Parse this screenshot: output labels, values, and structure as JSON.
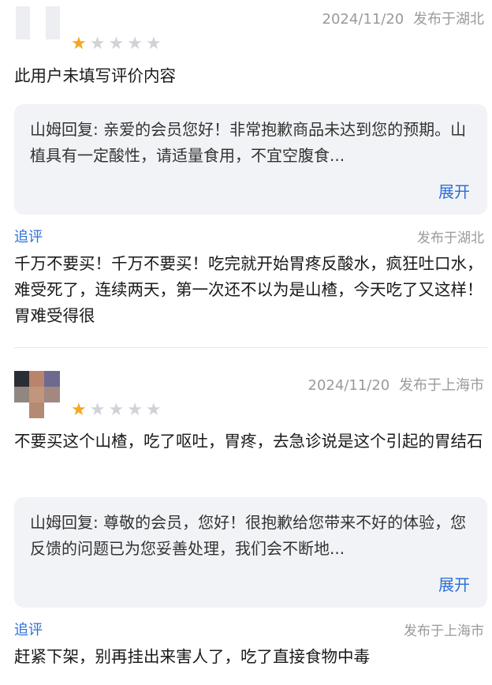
{
  "reviews": [
    {
      "date": "2024/11/20",
      "location": "发布于湖北",
      "rating": 1,
      "content": "此用户未填写评价内容",
      "reply": "山姆回复: 亲爱的会员您好！非常抱歉商品未达到您的预期。山植具有一定酸性，请适量食用，不宜空腹食...",
      "expand_label": "展开",
      "followup_label": "追评",
      "followup_location": "发布于湖北",
      "followup_text": "千万不要买！千万不要买！吃完就开始胃疼反酸水，疯狂吐口水，难受死了，连续两天，第一次还不以为是山楂，今天吃了又这样！胃难受得很"
    },
    {
      "date": "2024/11/20",
      "location": "发布于上海市",
      "rating": 1,
      "content": "不要买这个山楂，吃了呕吐，胃疼，去急诊说是这个引起的胃结石",
      "reply": "山姆回复: 尊敬的会员，您好！很抱歉给您带来不好的体验，您反馈的问题已为您妥善处理，我们会不断地...",
      "expand_label": "展开",
      "followup_label": "追评",
      "followup_location": "发布于上海市",
      "followup_text": "赶紧下架，别再挂出来害人了，吃了直接食物中毒"
    }
  ],
  "star_icon": "★",
  "colors": {
    "accent": "#2b6fd6",
    "star": "#f5a623",
    "reply_bg": "#f2f3f6"
  }
}
